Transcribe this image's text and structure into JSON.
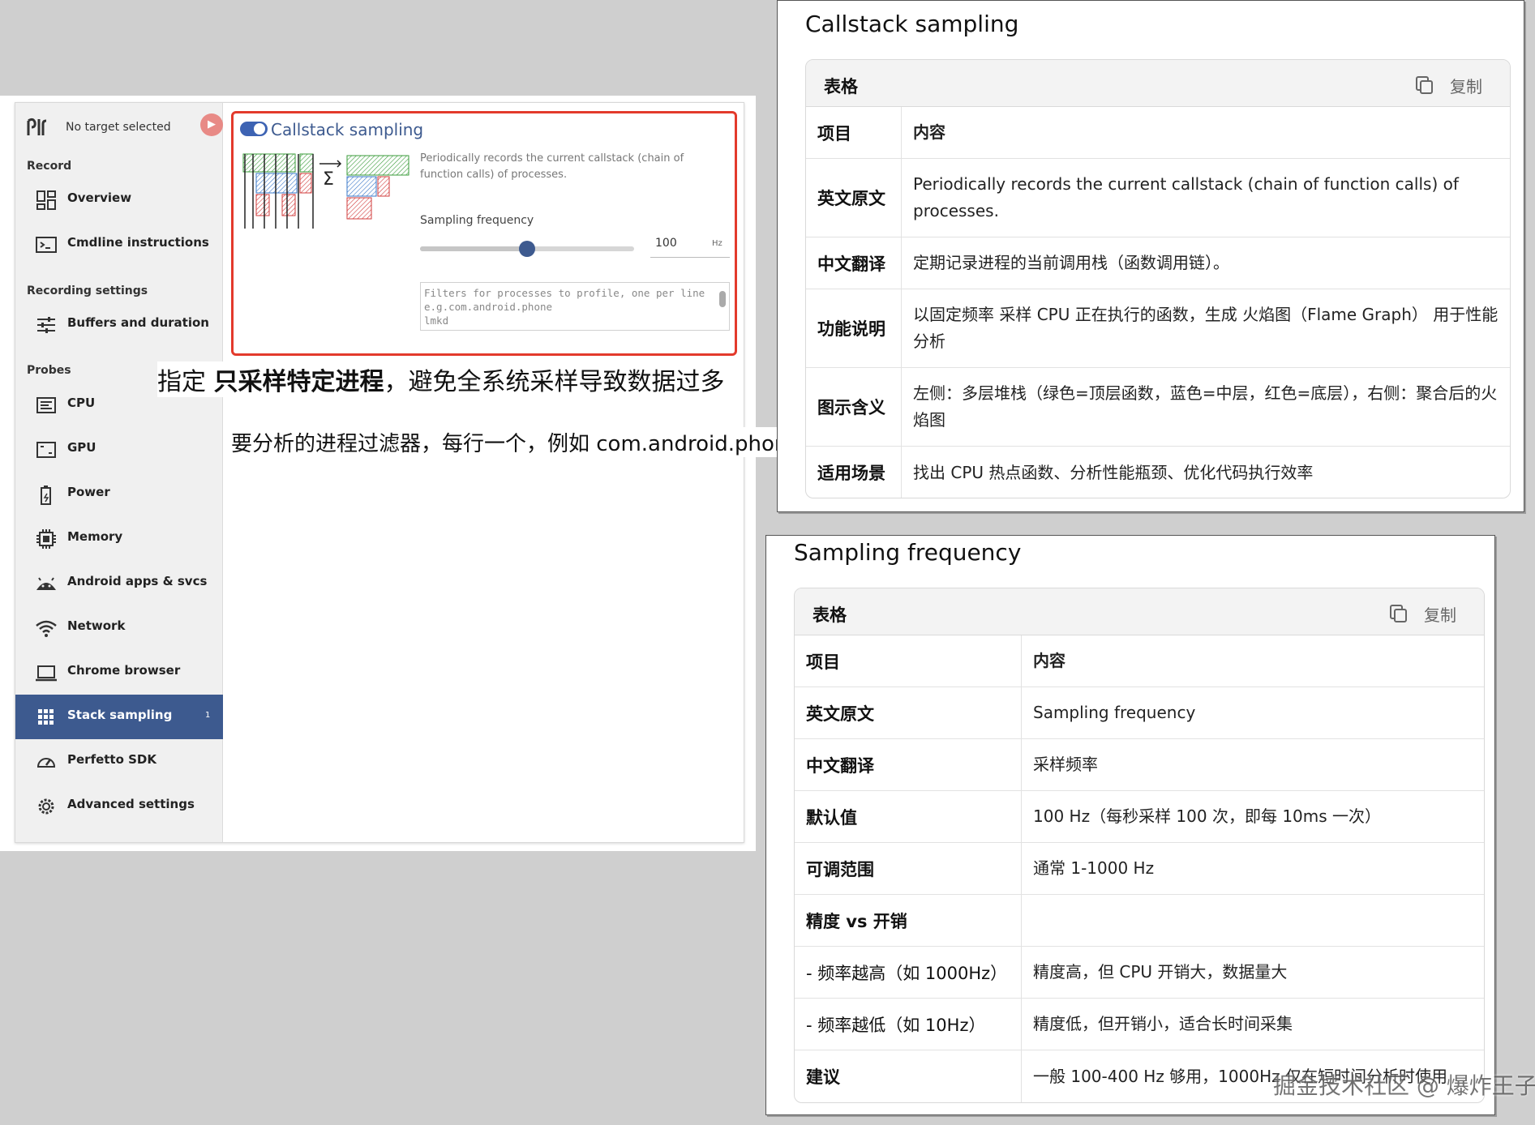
{
  "perfetto": {
    "target": {
      "label": "No target selected"
    },
    "sections": {
      "record": "Record",
      "recording_settings": "Recording settings",
      "probes": "Probes"
    },
    "nav": [
      {
        "label": "Overview",
        "icon": "grid-dashboard-icon"
      },
      {
        "label": "Cmdline instructions",
        "icon": "terminal-icon"
      },
      {
        "label": "Buffers and duration",
        "icon": "sliders-icon"
      },
      {
        "label": "CPU",
        "icon": "cpu-icon"
      },
      {
        "label": "GPU",
        "icon": "gpu-icon"
      },
      {
        "label": "Power",
        "icon": "battery-icon"
      },
      {
        "label": "Memory",
        "icon": "memory-chip-icon"
      },
      {
        "label": "Android apps & svcs",
        "icon": "android-icon"
      },
      {
        "label": "Network",
        "icon": "wifi-icon"
      },
      {
        "label": "Chrome browser",
        "icon": "laptop-icon"
      },
      {
        "label": "Stack sampling",
        "icon": "stack-grid-icon",
        "badge": "1",
        "active": true
      },
      {
        "label": "Perfetto SDK",
        "icon": "gauge-icon"
      },
      {
        "label": "Advanced settings",
        "icon": "gear-icon"
      }
    ],
    "probe": {
      "title": "Callstack sampling",
      "enabled": true,
      "description": "Periodically records the current callstack (chain of function calls) of processes.",
      "sampling_frequency_label": "Sampling frequency",
      "sampling_frequency_value": "100",
      "sampling_frequency_unit": "Hz",
      "slider_fraction": 0.5,
      "filter_placeholder": "Filters for processes to profile, one per line e.g.com.android.phone\nlmkd",
      "illustration_sum_symbol": "Σ"
    },
    "annotation_line1": "要分析的进程过滤器，每行一个，例如 com.android.phone",
    "annotation_line2_bold": "只采样特定进程",
    "annotation_line2_prefix": "指定 ",
    "annotation_line2_suffix": "，避免全系统采样导致数据过多"
  },
  "panel1": {
    "title": "Callstack sampling",
    "table_label": "表格",
    "copy_label": "复制",
    "header": [
      "项目",
      "内容"
    ],
    "rows": [
      [
        "英文原文",
        "Periodically records the current callstack (chain of function calls) of processes."
      ],
      [
        "中文翻译",
        "定期记录进程的当前调用栈（函数调用链）。"
      ],
      [
        "功能说明",
        "以固定频率 采样 CPU 正在执行的函数，生成 火焰图（Flame Graph） 用于性能分析"
      ],
      [
        "图示含义",
        "左侧：多层堆栈（绿色=顶层函数，蓝色=中层，红色=底层），右侧：聚合后的火焰图"
      ],
      [
        "适用场景",
        "找出 CPU 热点函数、分析性能瓶颈、优化代码执行效率"
      ]
    ]
  },
  "panel2": {
    "title": "Sampling frequency",
    "table_label": "表格",
    "copy_label": "复制",
    "header": [
      "项目",
      "内容"
    ],
    "rows": [
      [
        "英文原文",
        "Sampling frequency"
      ],
      [
        "中文翻译",
        "采样频率"
      ],
      [
        "默认值",
        "100 Hz（每秒采样 100 次，即每 10ms 一次）"
      ],
      [
        "可调范围",
        "通常 1-1000 Hz"
      ],
      [
        "精度 vs 开销",
        ""
      ],
      [
        "- 频率越高（如 1000Hz）",
        "精度高，但 CPU 开销大，数据量大"
      ],
      [
        "- 频率越低（如 10Hz）",
        "精度低，但开销小，适合长时间采集"
      ],
      [
        "建议",
        "一般 100-400 Hz 够用，1000Hz 仅在短时间分析时使用"
      ]
    ]
  },
  "watermark": "掘金技术社区 @ 爆炸王子"
}
